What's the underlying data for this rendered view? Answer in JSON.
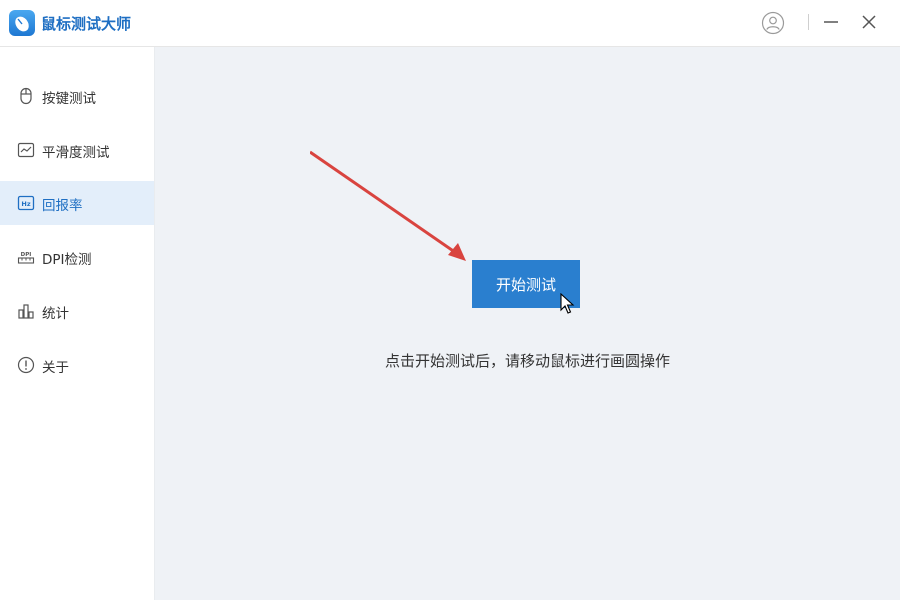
{
  "app": {
    "title": "鼠标测试大师",
    "logo_icon": "mouse-logo-icon"
  },
  "titlebar": {
    "user_icon": "user-icon",
    "minimize_icon": "minimize-icon",
    "close_icon": "close-icon"
  },
  "sidebar": {
    "items": [
      {
        "label": "按键测试",
        "icon": "mouse-icon",
        "active": false
      },
      {
        "label": "平滑度测试",
        "icon": "chart-line-icon",
        "active": false
      },
      {
        "label": "回报率",
        "icon": "hz-icon",
        "active": true
      },
      {
        "label": "DPI检测",
        "icon": "dpi-ruler-icon",
        "active": false
      },
      {
        "label": "统计",
        "icon": "bar-chart-icon",
        "active": false
      },
      {
        "label": "关于",
        "icon": "info-icon",
        "active": false
      }
    ]
  },
  "main": {
    "start_button": "开始测试",
    "hint": "点击开始测试后，请移动鼠标进行画圆操作"
  },
  "colors": {
    "accent": "#2a7fcf",
    "active_bg": "#e3eefa",
    "main_bg": "#eff2f6",
    "arrow": "#d9443f"
  }
}
